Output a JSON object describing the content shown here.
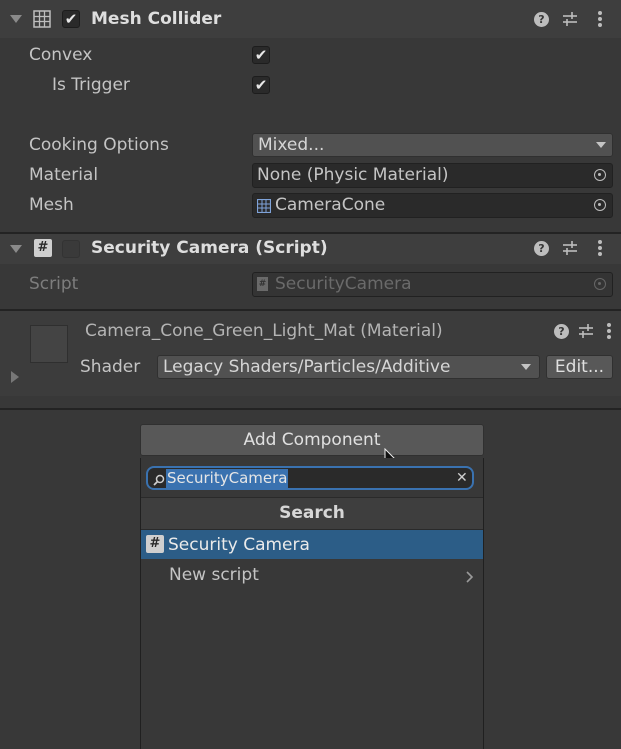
{
  "mesh_collider": {
    "title": "Mesh Collider",
    "convex_label": "Convex",
    "is_trigger_label": "Is Trigger",
    "cooking_label": "Cooking Options",
    "cooking_value": "Mixed...",
    "material_label": "Material",
    "material_value": "None (Physic Material)",
    "mesh_label": "Mesh",
    "mesh_value": "CameraCone"
  },
  "security_camera": {
    "title": "Security Camera (Script)",
    "script_label": "Script",
    "script_value": "SecurityCamera"
  },
  "material": {
    "title": "Camera_Cone_Green_Light_Mat (Material)",
    "shader_label": "Shader",
    "shader_value": "Legacy Shaders/Particles/Additive",
    "edit_label": "Edit..."
  },
  "add_component": {
    "button_label": "Add Component",
    "search_value": "SecurityCamera",
    "header": "Search",
    "items": [
      {
        "label": "Security Camera"
      },
      {
        "label": "New script"
      }
    ]
  },
  "colors": {
    "background": "#383838",
    "header": "#3e3e3e",
    "selection": "#2c5d87",
    "search_highlight": "#3a72b0"
  }
}
